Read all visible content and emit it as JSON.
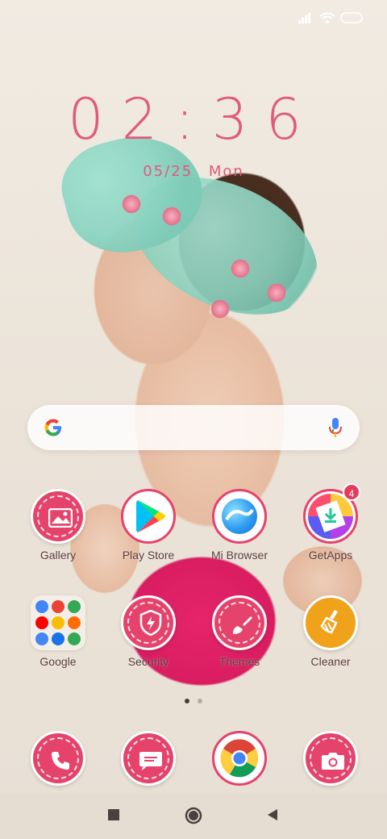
{
  "status": {
    "icons": [
      "signal-icon",
      "wifi-icon",
      "battery-icon"
    ]
  },
  "lockclock": {
    "time": "02:36",
    "date": "05/25",
    "weekday": "Mon"
  },
  "search": {
    "icon_left": "google-icon",
    "icon_right": "mic-icon"
  },
  "apps_row1": [
    {
      "label": "Gallery",
      "icon": "gallery-icon"
    },
    {
      "label": "Play Store",
      "icon": "play-store-icon"
    },
    {
      "label": "Mi Browser",
      "icon": "mi-browser-icon"
    },
    {
      "label": "GetApps",
      "icon": "getapps-icon",
      "badge": "4"
    }
  ],
  "apps_row2": [
    {
      "label": "Google",
      "icon": "google-folder-icon"
    },
    {
      "label": "Security",
      "icon": "security-icon"
    },
    {
      "label": "Themes",
      "icon": "themes-icon"
    },
    {
      "label": "Cleaner",
      "icon": "cleaner-icon"
    }
  ],
  "dock": [
    {
      "icon": "phone-icon"
    },
    {
      "icon": "messages-icon"
    },
    {
      "icon": "chrome-icon"
    },
    {
      "icon": "camera-icon"
    }
  ],
  "page_indicator": {
    "count": 2,
    "active": 0
  },
  "colors": {
    "accent": "#e5436b",
    "clock": "#e05a7a"
  }
}
